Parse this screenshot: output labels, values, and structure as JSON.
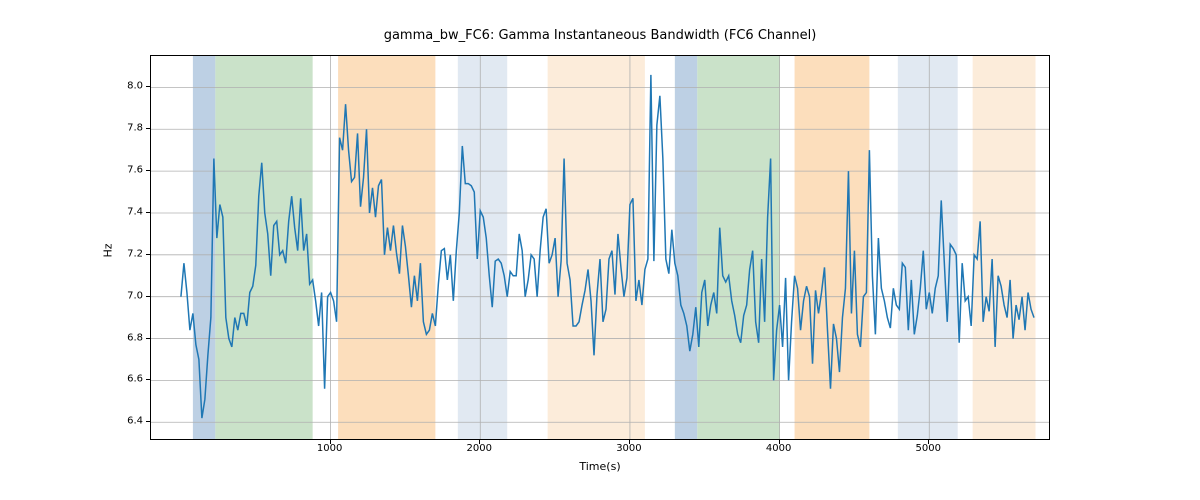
{
  "chart_data": {
    "type": "line",
    "title": "gamma_bw_FC6: Gamma Instantaneous Bandwidth (FC6 Channel)",
    "xlabel": "Time(s)",
    "ylabel": "Hz",
    "xlim": [
      -200,
      5800
    ],
    "ylim": [
      6.32,
      8.15
    ],
    "xticks": [
      1000,
      2000,
      3000,
      4000,
      5000
    ],
    "yticks": [
      6.4,
      6.6,
      6.8,
      7.0,
      7.2,
      7.4,
      7.6,
      7.8,
      8.0
    ],
    "series": [
      {
        "name": "gamma_bw_FC6",
        "color": "#1f77b4",
        "x_start": 0,
        "x_step": 20,
        "values": [
          7.0,
          7.16,
          7.02,
          6.84,
          6.92,
          6.77,
          6.7,
          6.42,
          6.51,
          6.72,
          6.9,
          7.66,
          7.28,
          7.44,
          7.38,
          6.9,
          6.8,
          6.76,
          6.9,
          6.84,
          6.92,
          6.92,
          6.86,
          7.02,
          7.05,
          7.15,
          7.48,
          7.64,
          7.4,
          7.3,
          7.1,
          7.34,
          7.36,
          7.2,
          7.22,
          7.16,
          7.36,
          7.48,
          7.33,
          7.22,
          7.47,
          7.22,
          7.3,
          7.06,
          7.08,
          6.98,
          6.86,
          7.02,
          6.56,
          7.0,
          7.02,
          6.98,
          6.88,
          7.76,
          7.7,
          7.92,
          7.7,
          7.55,
          7.57,
          7.78,
          7.43,
          7.57,
          7.8,
          7.4,
          7.52,
          7.38,
          7.53,
          7.56,
          7.2,
          7.33,
          7.22,
          7.34,
          7.21,
          7.11,
          7.34,
          7.24,
          7.1,
          6.95,
          7.1,
          6.98,
          7.16,
          6.88,
          6.82,
          6.84,
          6.92,
          6.86,
          7.06,
          7.22,
          7.23,
          7.08,
          7.2,
          6.98,
          7.22,
          7.4,
          7.72,
          7.54,
          7.54,
          7.53,
          7.5,
          7.18,
          7.41,
          7.38,
          7.28,
          7.1,
          6.95,
          7.17,
          7.18,
          7.16,
          7.1,
          7.0,
          7.12,
          7.1,
          7.1,
          7.3,
          7.22,
          7.0,
          7.08,
          7.2,
          7.18,
          7.0,
          7.22,
          7.38,
          7.42,
          7.16,
          7.2,
          7.28,
          7.0,
          7.17,
          7.66,
          7.16,
          7.08,
          6.86,
          6.86,
          6.88,
          6.96,
          7.03,
          7.13,
          6.98,
          6.72,
          7.01,
          7.18,
          6.88,
          6.94,
          7.18,
          7.22,
          7.01,
          7.3,
          7.14,
          7.0,
          7.09,
          7.44,
          7.47,
          6.98,
          7.08,
          6.96,
          7.13,
          7.18,
          8.06,
          7.17,
          7.82,
          7.96,
          7.66,
          7.18,
          7.11,
          7.32,
          7.16,
          7.1,
          6.96,
          6.92,
          6.86,
          6.74,
          6.82,
          6.95,
          6.76,
          7.02,
          7.08,
          6.86,
          6.96,
          7.02,
          6.92,
          7.33,
          7.1,
          7.07,
          7.1,
          6.98,
          6.91,
          6.82,
          6.78,
          6.91,
          6.96,
          7.13,
          7.22,
          6.88,
          6.78,
          7.18,
          6.88,
          7.38,
          7.66,
          6.6,
          6.84,
          6.96,
          6.76,
          7.09,
          6.6,
          6.88,
          7.1,
          7.04,
          6.84,
          6.98,
          7.05,
          7.0,
          6.68,
          7.03,
          6.92,
          7.02,
          7.14,
          6.84,
          6.56,
          6.87,
          6.8,
          6.64,
          6.9,
          7.04,
          7.6,
          6.92,
          7.22,
          6.82,
          6.76,
          7.0,
          7.02,
          7.7,
          7.1,
          6.82,
          7.28,
          7.04,
          6.98,
          6.9,
          6.85,
          7.04,
          6.96,
          6.94,
          7.16,
          7.14,
          6.84,
          7.08,
          6.82,
          6.91,
          7.04,
          7.22,
          6.94,
          7.02,
          6.92,
          7.04,
          7.1,
          7.46,
          7.17,
          6.88,
          7.25,
          7.23,
          7.2,
          6.78,
          7.16,
          6.98,
          7.0,
          6.86,
          7.2,
          7.18,
          7.36,
          6.88,
          7.0,
          6.93,
          7.18,
          6.76,
          7.1,
          7.05,
          6.96,
          6.9,
          7.08,
          6.8,
          6.96,
          6.89,
          7.0,
          6.84,
          7.02,
          6.94,
          6.9
        ]
      }
    ],
    "bands": [
      {
        "x0": 80,
        "x1": 230,
        "color": "#b1c8df",
        "alpha": 0.85
      },
      {
        "x0": 230,
        "x1": 880,
        "color": "#c1ddbf",
        "alpha": 0.85
      },
      {
        "x0": 1050,
        "x1": 1700,
        "color": "#fbd8b0",
        "alpha": 0.85
      },
      {
        "x0": 1850,
        "x1": 2180,
        "color": "#dce5f0",
        "alpha": 0.85
      },
      {
        "x0": 2450,
        "x1": 3100,
        "color": "#fce9d4",
        "alpha": 0.85
      },
      {
        "x0": 3300,
        "x1": 3450,
        "color": "#b1c8df",
        "alpha": 0.85
      },
      {
        "x0": 3450,
        "x1": 4000,
        "color": "#c1ddbf",
        "alpha": 0.85
      },
      {
        "x0": 4100,
        "x1": 4600,
        "color": "#fbd8b0",
        "alpha": 0.85
      },
      {
        "x0": 4790,
        "x1": 5190,
        "color": "#dce5f0",
        "alpha": 0.85
      },
      {
        "x0": 5290,
        "x1": 5710,
        "color": "#fce9d4",
        "alpha": 0.85
      }
    ]
  }
}
